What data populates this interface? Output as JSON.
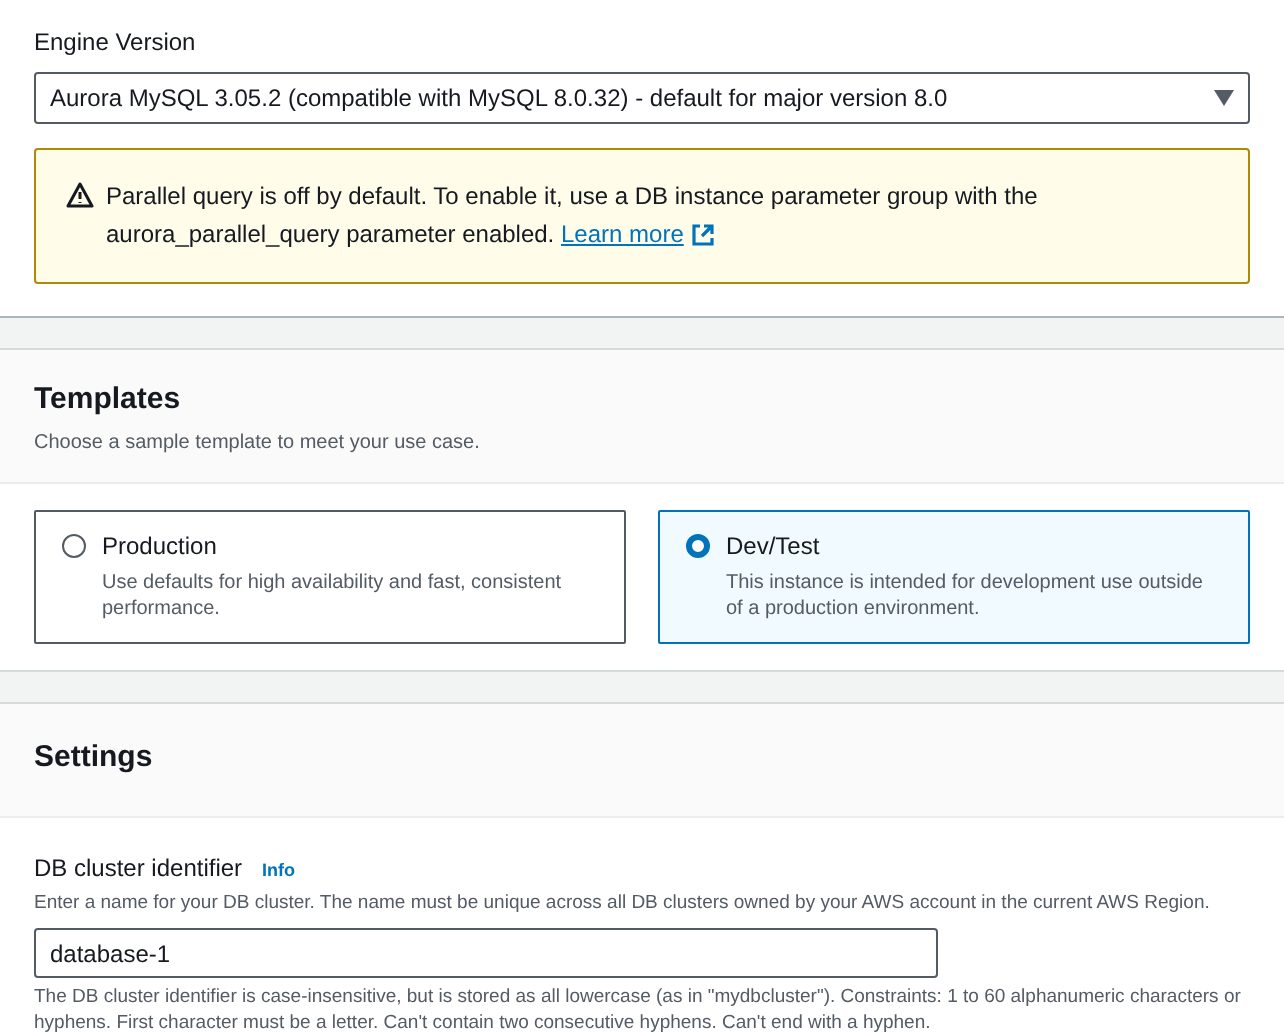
{
  "engine": {
    "label": "Engine Version",
    "value": "Aurora MySQL 3.05.2 (compatible with MySQL 8.0.32) - default for major version 8.0"
  },
  "alert": {
    "text": "Parallel query is off by default. To enable it, use a DB instance parameter group with the aurora_parallel_query parameter enabled.",
    "link": "Learn more"
  },
  "templates": {
    "title": "Templates",
    "subtitle": "Choose a sample template to meet your use case.",
    "options": [
      {
        "label": "Production",
        "description": "Use defaults for high availability and fast, consistent performance.",
        "selected": false
      },
      {
        "label": "Dev/Test",
        "description": "This instance is intended for development use outside of a production environment.",
        "selected": true
      }
    ]
  },
  "settings": {
    "title": "Settings",
    "field": {
      "label": "DB cluster identifier",
      "info": "Info",
      "description": "Enter a name for your DB cluster. The name must be unique across all DB clusters owned by your AWS account in the current AWS Region.",
      "value": "database-1",
      "constraint": "The DB cluster identifier is case-insensitive, but is stored as all lowercase (as in \"mydbcluster\"). Constraints: 1 to 60 alphanumeric characters or hyphens. First character must be a letter. Can't contain two consecutive hyphens. Can't end with a hyphen."
    }
  }
}
